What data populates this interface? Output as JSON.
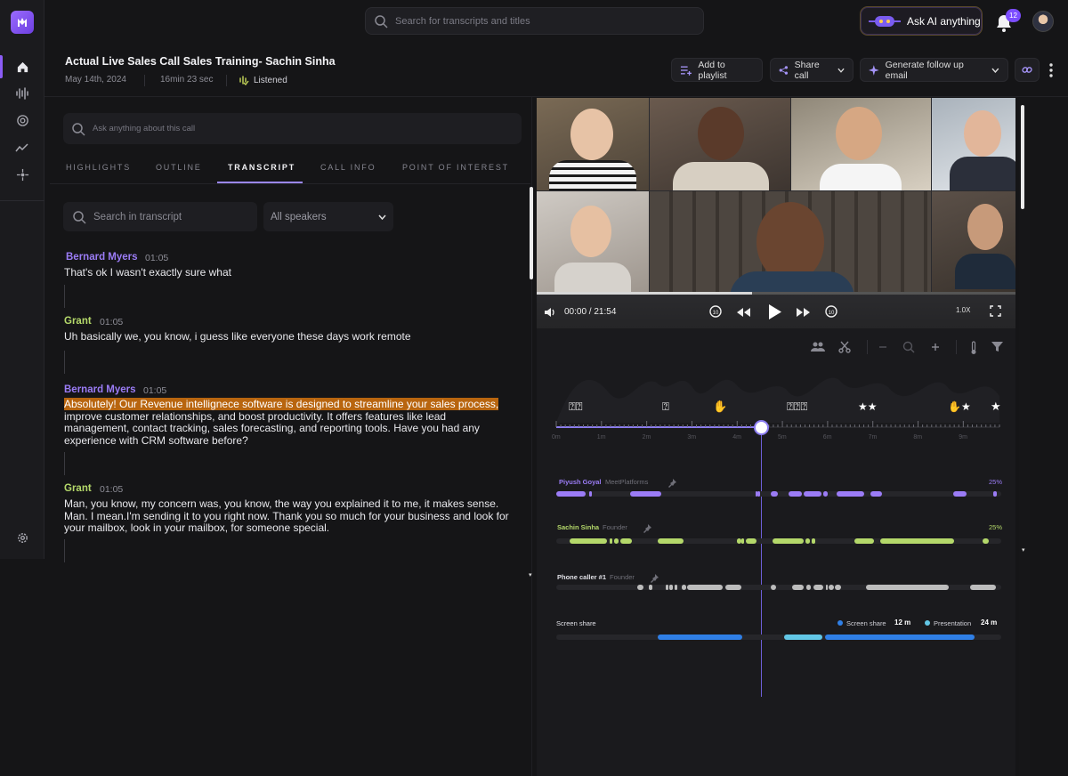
{
  "colors": {
    "accent": "#8b5cf6",
    "speaker1": "#9b7cf6",
    "speaker2": "#b4d86a",
    "speaker3": "#bdbdbd",
    "screenshare": "#2f7fe6",
    "presentation": "#62c7e6",
    "highlight": "#b8650f"
  },
  "sidebar": {
    "items": [
      {
        "icon": "home-icon",
        "active": true
      },
      {
        "icon": "waveform-icon"
      },
      {
        "icon": "target-icon"
      },
      {
        "icon": "trend-icon"
      },
      {
        "icon": "integrations-icon"
      },
      {
        "icon": "settings-icon"
      }
    ]
  },
  "topbar": {
    "search_placeholder": "Search for transcripts and titles",
    "ask_ai_label": "Ask AI anything",
    "notifications_count": "12"
  },
  "call": {
    "title": "Actual Live Sales Call Sales Training- Sachin Sinha",
    "date": "May 14th, 2024",
    "duration": "16min 23 sec",
    "status": "Listened"
  },
  "actions": {
    "add_playlist": "Add to playlist",
    "share_call": "Share call",
    "followup": "Generate follow up email"
  },
  "panel": {
    "ask_placeholder": "Ask anything about this call",
    "tabs": [
      "HIGHLIGHTS",
      "OUTLINE",
      "TRANSCRIPT",
      "CALL INFO",
      "POINT OF INTEREST"
    ],
    "active_tab": "TRANSCRIPT",
    "transcript_search_placeholder": "Search in transcript",
    "speaker_filter": "All speakers"
  },
  "transcript": [
    {
      "speaker": "Bernard Myers",
      "time": "01:05",
      "text": "That's ok I wasn't exactly sure what"
    },
    {
      "speaker": "Grant",
      "time": "01:05",
      "text": "Uh basically we, you know, i guess like everyone these days work remote"
    },
    {
      "speaker": "Bernard Myers",
      "time": "01:05",
      "highlight": "Absolutely! Our Revenue intellignece software is designed to streamline your sales process,",
      "text": "improve customer relationships, and boost productivity. It offers features like lead management, contact tracking, sales forecasting, and reporting tools. Have you had any experience with CRM software before?"
    },
    {
      "speaker": "Grant",
      "time": "01:05",
      "text": "Man, you know, my concern was, you know, the way you explained it to me, it makes sense. Man. I mean.I'm sending it to you right now. Thank you so much for your business and look for your mailbox, look in your mailbox, for someone special."
    }
  ],
  "player": {
    "time": "00:00 / 21:54",
    "speed": "1.0X",
    "progress": 0.45
  },
  "timeline": {
    "ticks": [
      "0m",
      "1m",
      "2m",
      "3m",
      "4m",
      "5m",
      "6m",
      "7m",
      "8m",
      "9m"
    ],
    "playhead_minute": 4.6
  },
  "speakers": [
    {
      "name": "Piyush Goyal",
      "role": "MeetPlatforms",
      "pct": "25%"
    },
    {
      "name": "Sachin Sinha",
      "role": "Founder",
      "pct": "25%"
    },
    {
      "name": "Phone caller #1",
      "role": "Founder",
      "pct": ""
    }
  ],
  "screenshare": {
    "label": "Screen share",
    "legend": [
      {
        "name": "Screen share",
        "value": "12 m"
      },
      {
        "name": "Presentation",
        "value": "24 m"
      }
    ]
  }
}
